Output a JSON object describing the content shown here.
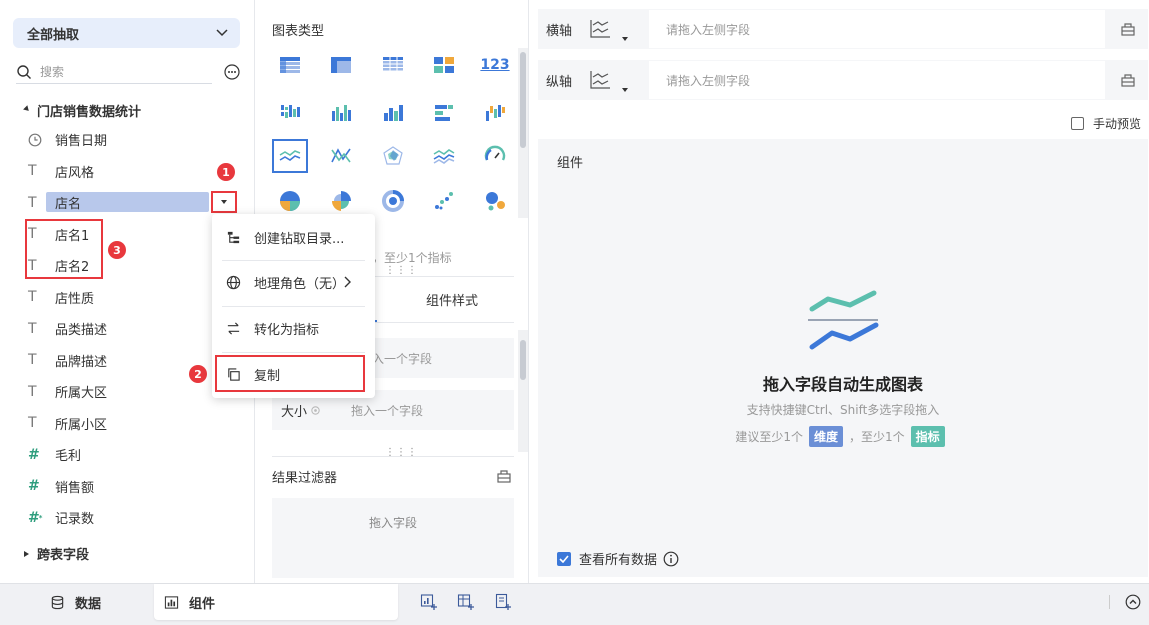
{
  "left": {
    "extract_label": "全部抽取",
    "search_placeholder": "搜索",
    "root_table": "门店销售数据统计",
    "fields": [
      {
        "label": "销售日期",
        "type": "date"
      },
      {
        "label": "店风格",
        "type": "text"
      },
      {
        "label": "店名",
        "type": "text"
      },
      {
        "label": "店名1",
        "type": "text"
      },
      {
        "label": "店名2",
        "type": "text"
      },
      {
        "label": "店性质",
        "type": "text"
      },
      {
        "label": "品类描述",
        "type": "text"
      },
      {
        "label": "品牌描述",
        "type": "text"
      },
      {
        "label": "所属大区",
        "type": "text"
      },
      {
        "label": "所属小区",
        "type": "text"
      },
      {
        "label": "毛利",
        "type": "number"
      },
      {
        "label": "销售额",
        "type": "number"
      },
      {
        "label": "记录数",
        "type": "count"
      }
    ],
    "cross_table": "跨表字段"
  },
  "context_menu": {
    "items": [
      "创建钻取目录...",
      "地理角色（无）",
      "转化为指标",
      "复制"
    ]
  },
  "badges": [
    "1",
    "2",
    "3"
  ],
  "middle": {
    "chart_type_title": "图表类型",
    "chart_text_icon": "123",
    "hint": "，至少1个指标",
    "tab_style": "组件样式",
    "slot1_placeholder": "入一个字段",
    "slot2_label": "大小",
    "slot2_placeholder": "拖入一个字段",
    "filter_title": "结果过滤器",
    "filter_placeholder": "拖入字段"
  },
  "right": {
    "x_axis_label": "横轴",
    "y_axis_label": "纵轴",
    "axis_placeholder": "请拖入左侧字段",
    "manual_preview": "手动预览",
    "widget_title": "组件",
    "empty_title": "拖入字段自动生成图表",
    "empty_sub": "支持快捷键Ctrl、Shift多选字段拖入",
    "rec_prefix": "建议至少1个",
    "rec_dim": "维度",
    "rec_mid": "，至少1个",
    "rec_met": "指标",
    "view_all": "查看所有数据"
  },
  "bottom": {
    "tab_data": "数据",
    "tab_widget": "组件"
  },
  "colors": {
    "accent": "#3c78d8",
    "highlight_red": "#e8383d",
    "dimension_tag": "#6b8fd6",
    "metric_tag": "#5cbfae"
  }
}
